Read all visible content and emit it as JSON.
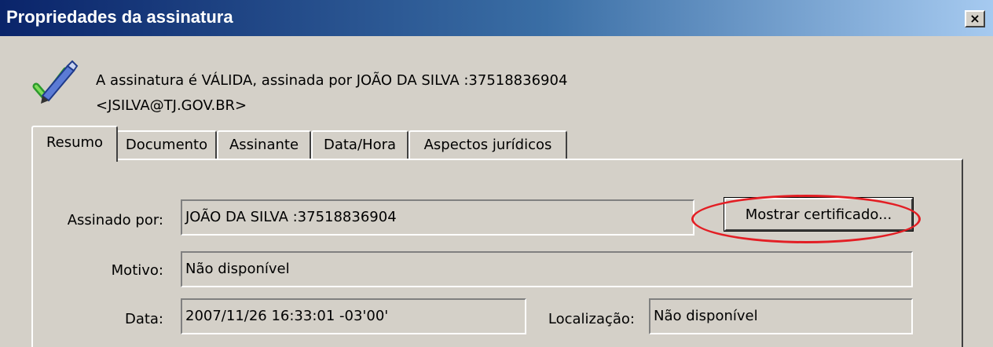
{
  "window": {
    "title": "Propriedades da assinatura",
    "close_label": "×"
  },
  "status": {
    "line1": "A assinatura é VÁLIDA, assinada por JOÃO DA SILVA :37518836904",
    "line2": "<JSILVA@TJ.GOV.BR>"
  },
  "tabs": [
    {
      "label": "Resumo",
      "active": true
    },
    {
      "label": "Documento",
      "active": false
    },
    {
      "label": "Assinante",
      "active": false
    },
    {
      "label": "Data/Hora",
      "active": false
    },
    {
      "label": "Aspectos jurídicos",
      "active": false
    }
  ],
  "summary": {
    "signed_by_label": "Assinado por:",
    "signed_by_value": "JOÃO DA SILVA :37518836904",
    "show_certificate_button": "Mostrar certificado...",
    "reason_label": "Motivo:",
    "reason_value": "Não disponível",
    "date_label": "Data:",
    "date_value": "2007/11/26 16:33:01 -03'00'",
    "location_label": "Localização:",
    "location_value": "Não disponível"
  },
  "colors": {
    "titlebar_start": "#0a246a",
    "titlebar_end": "#a6caf0",
    "dialog_bg": "#d4d0c8",
    "highlight": "#e31e24"
  },
  "icons": {
    "signature": "pen-check-icon"
  }
}
